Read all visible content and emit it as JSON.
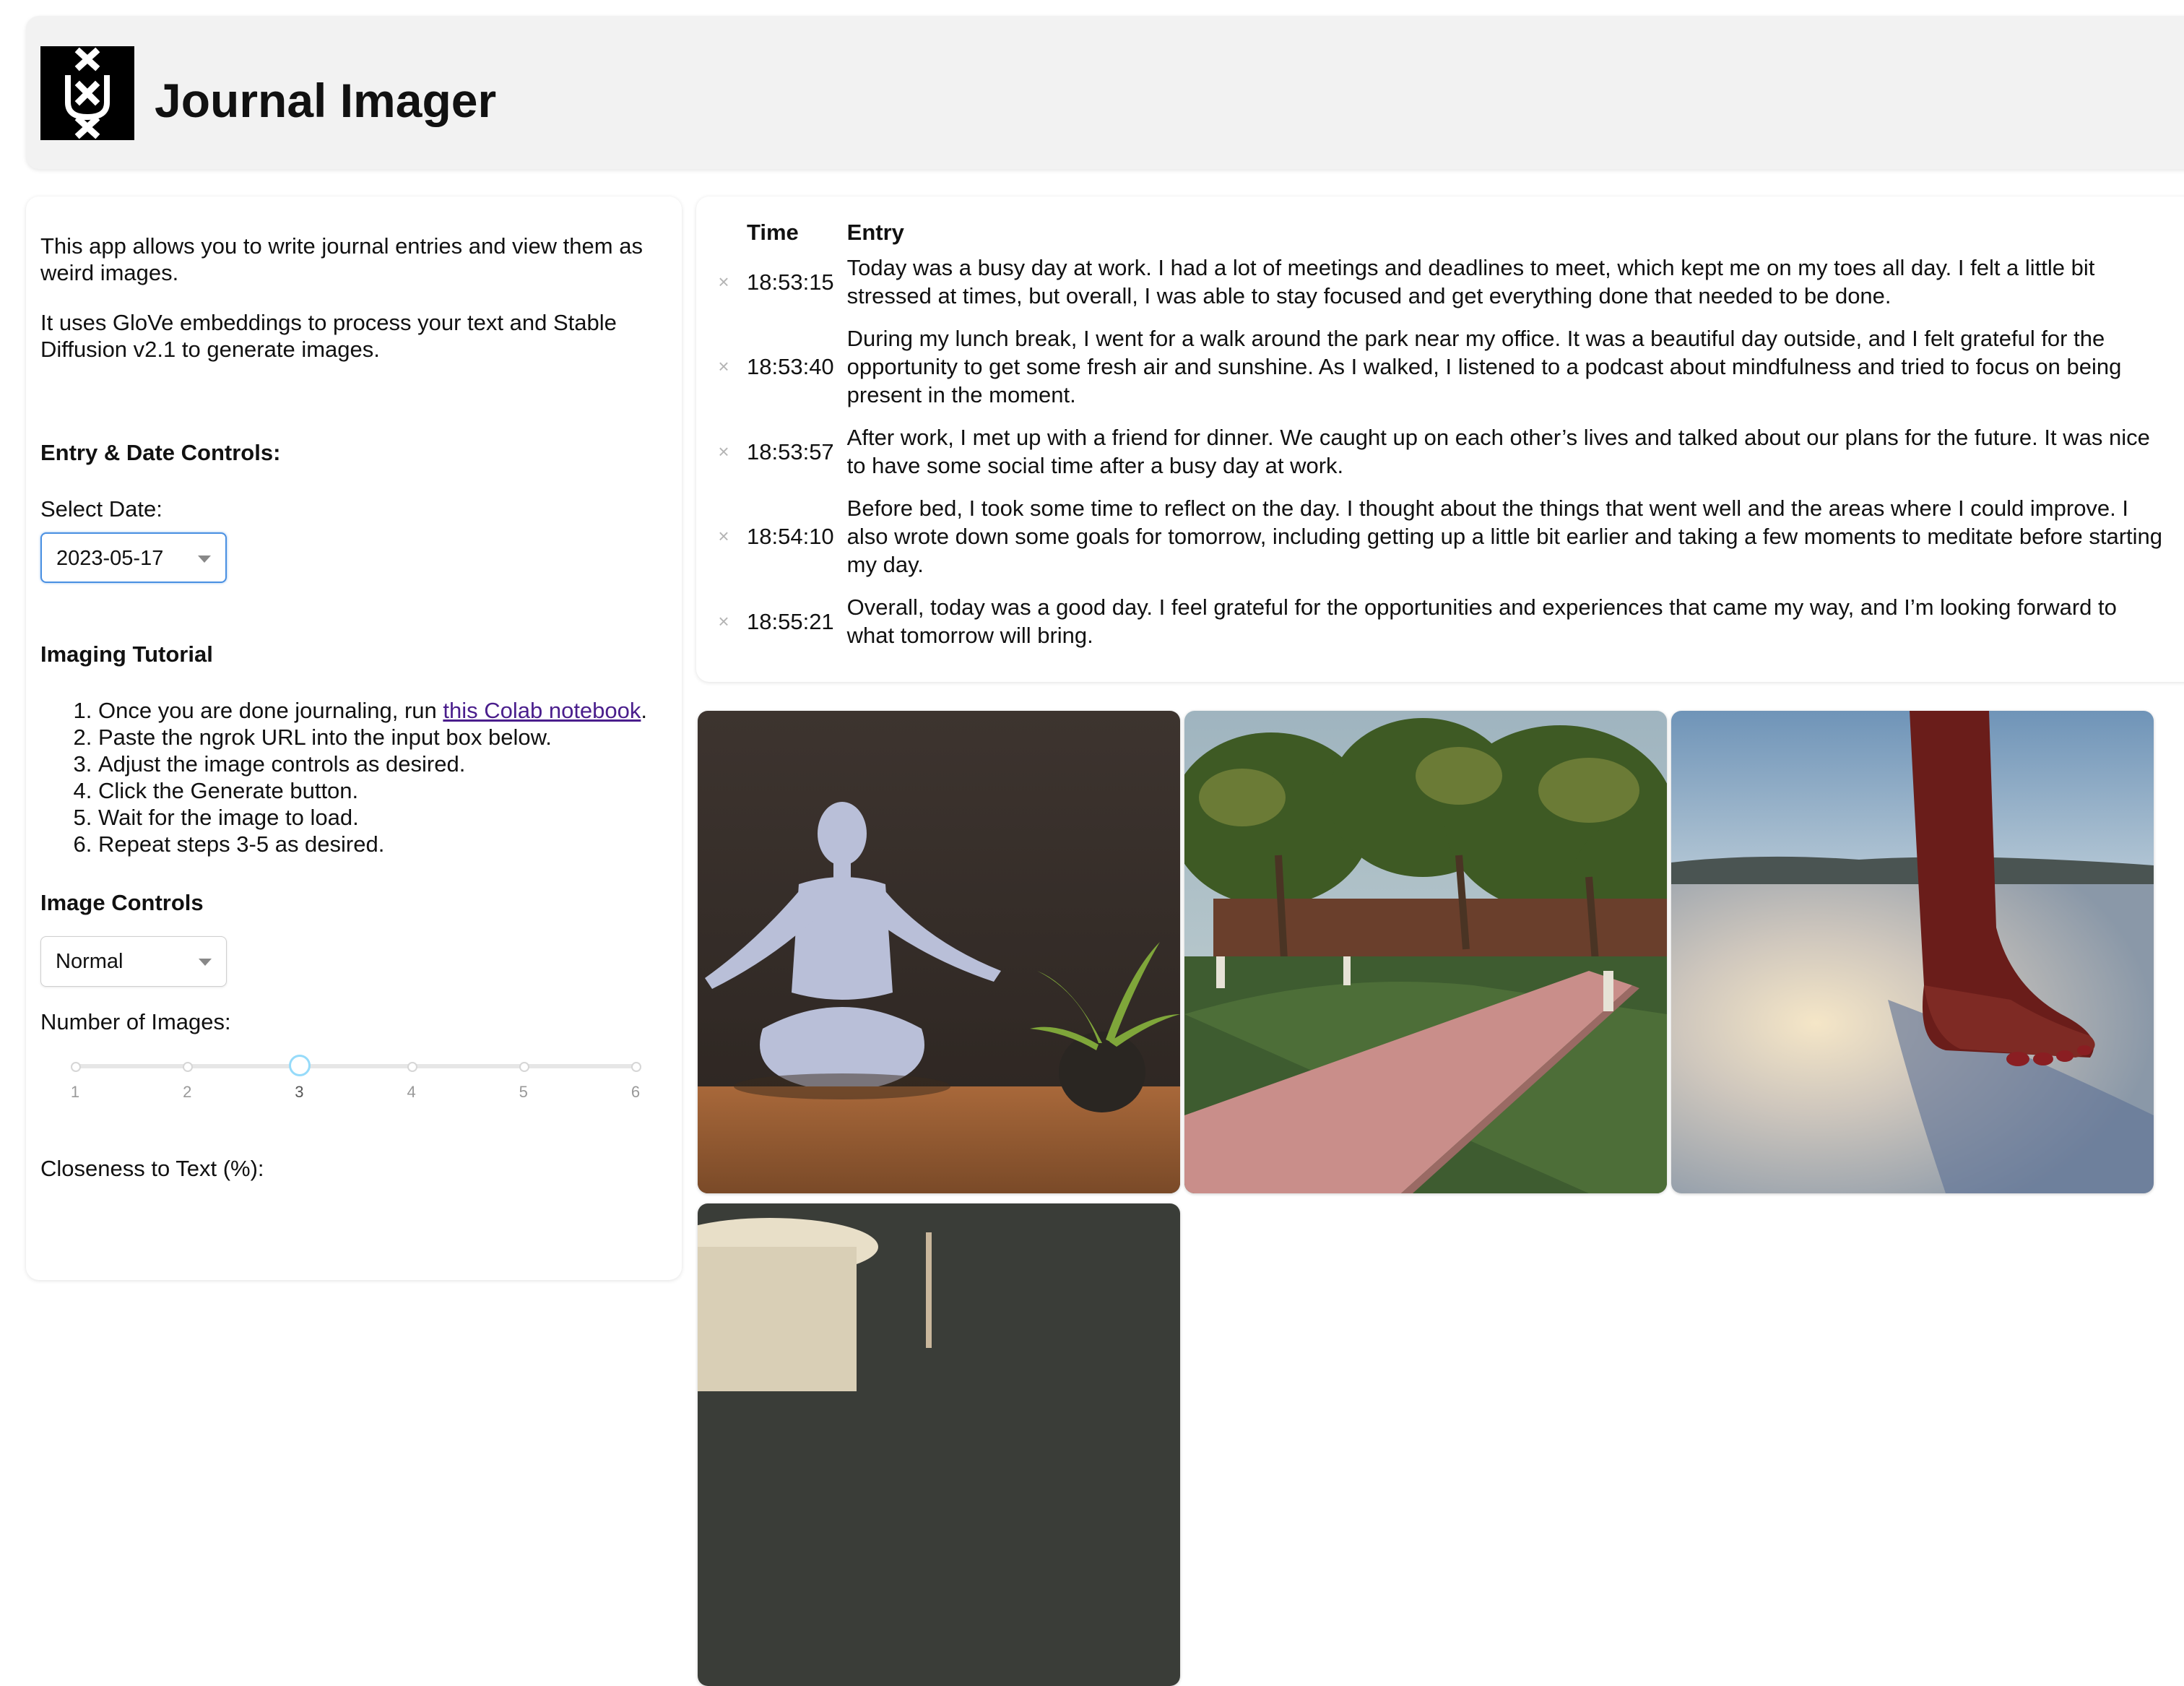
{
  "header": {
    "title": "Journal Imager",
    "logo_icon": "amsterdam-crosses-logo"
  },
  "sidebar": {
    "intro_1": "This app allows you to write journal entries and view them as weird images.",
    "intro_2": "It uses GloVe embeddings to process your text and Stable Diffusion v2.1 to generate images.",
    "entry_controls_title": "Entry & Date Controls:",
    "select_date_label": "Select Date:",
    "selected_date": "2023-05-17",
    "tutorial_title": "Imaging Tutorial",
    "tutorial_steps": {
      "step1_prefix": "Once you are done journaling, run ",
      "step1_link": "this Colab notebook",
      "step1_suffix": ".",
      "step2": "Paste the ngrok URL into the input box below.",
      "step3": "Adjust the image controls as desired.",
      "step4": "Click the Generate button.",
      "step5": "Wait for the image to load.",
      "step6": "Repeat steps 3-5 as desired."
    },
    "image_controls_title": "Image Controls",
    "style_selected": "Normal",
    "num_images_label": "Number of Images:",
    "num_images": {
      "min": 1,
      "max": 6,
      "value": 3,
      "ticks": [
        "1",
        "2",
        "3",
        "4",
        "5",
        "6"
      ]
    },
    "closeness_label": "Closeness to Text (%):"
  },
  "journal": {
    "columns": {
      "time": "Time",
      "entry": "Entry"
    },
    "delete_icon": "×",
    "rows": [
      {
        "time": "18:53:15",
        "entry": "Today was a busy day at work. I had a lot of meetings and deadlines to meet, which kept me on my toes all day. I felt a little bit stressed at times, but overall, I was able to stay focused and get everything done that needed to be done."
      },
      {
        "time": "18:53:40",
        "entry": "During my lunch break, I went for a walk around the park near my office. It was a beautiful day outside, and I felt grateful for the opportunity to get some fresh air and sunshine. As I walked, I listened to a podcast about mindfulness and tried to focus on being present in the moment."
      },
      {
        "time": "18:53:57",
        "entry": "After work, I met up with a friend for dinner. We caught up on each other’s lives and talked about our plans for the future. It was nice to have some social time after a busy day at work."
      },
      {
        "time": "18:54:10",
        "entry": "Before bed, I took some time to reflect on the day. I thought about the things that went well and the areas where I could improve. I also wrote down some goals for tomorrow, including getting up a little bit earlier and taking a few moments to meditate before starting my day."
      },
      {
        "time": "18:55:21",
        "entry": "Overall, today was a good day. I feel grateful for the opportunities and experiences that came my way, and I’m looking forward to what tomorrow will bring."
      }
    ]
  },
  "gallery": {
    "images": [
      {
        "name": "generated-image-meditating-figure"
      },
      {
        "name": "generated-image-park-path"
      },
      {
        "name": "generated-image-foot-on-beach"
      },
      {
        "name": "generated-image-cup"
      }
    ]
  }
}
